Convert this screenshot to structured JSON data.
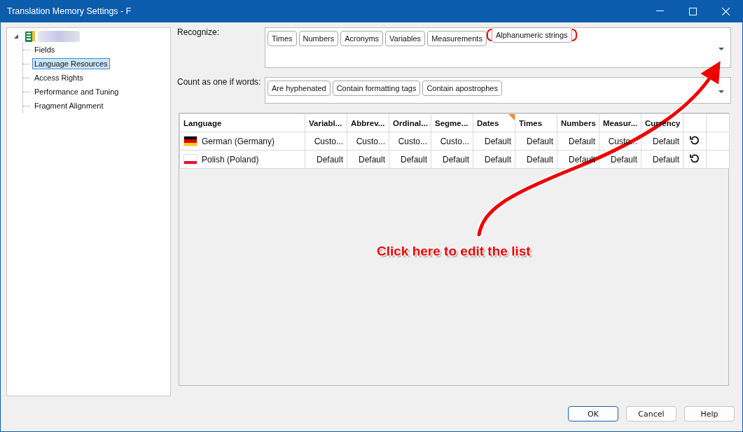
{
  "window": {
    "title": "Translation Memory Settings - F"
  },
  "tree": {
    "root": {
      "expanded": true,
      "children": [
        {
          "label": "Fields",
          "selected": false
        },
        {
          "label": "Language Resources",
          "selected": true
        },
        {
          "label": "Access Rights",
          "selected": false
        },
        {
          "label": "Performance and Tuning",
          "selected": false
        },
        {
          "label": "Fragment Alignment",
          "selected": false
        }
      ]
    }
  },
  "recognize": {
    "label": "Recognize:",
    "chips": [
      {
        "label": "Times",
        "highlighted": false
      },
      {
        "label": "Numbers",
        "highlighted": false
      },
      {
        "label": "Acronyms",
        "highlighted": false
      },
      {
        "label": "Variables",
        "highlighted": false
      },
      {
        "label": "Measurements",
        "highlighted": false
      },
      {
        "label": "Alphanumeric strings",
        "highlighted": true
      }
    ]
  },
  "count_as_one": {
    "label": "Count as one if words:",
    "chips": [
      {
        "label": "Are hyphenated"
      },
      {
        "label": "Contain formatting tags"
      },
      {
        "label": "Contain apostrophes"
      }
    ]
  },
  "table": {
    "columns": [
      {
        "label": "Language",
        "marked": false
      },
      {
        "label": "Variabl...",
        "marked": false
      },
      {
        "label": "Abbrev...",
        "marked": false
      },
      {
        "label": "Ordinal...",
        "marked": false
      },
      {
        "label": "Segme...",
        "marked": false
      },
      {
        "label": "Dates",
        "marked": true
      },
      {
        "label": "Times",
        "marked": false
      },
      {
        "label": "Numbers",
        "marked": false
      },
      {
        "label": "Measur...",
        "marked": false
      },
      {
        "label": "Currency",
        "marked": false
      }
    ],
    "rows": [
      {
        "kind": "de",
        "cells": [
          "German (Germany)",
          "Custo...",
          "Custo...",
          "Custo...",
          "Custo...",
          "Default",
          "Default",
          "Default",
          "Custo...",
          "Default"
        ]
      },
      {
        "kind": "pl",
        "cells": [
          "Polish (Poland)",
          "Default",
          "Default",
          "Default",
          "Default",
          "Default",
          "Default",
          "Default",
          "Default",
          "Default"
        ]
      }
    ]
  },
  "annotation": {
    "text": "Click here to edit the list"
  },
  "buttons": [
    {
      "label": "OK",
      "default": true
    },
    {
      "label": "Cancel",
      "default": false
    },
    {
      "label": "Help",
      "default": false
    }
  ]
}
